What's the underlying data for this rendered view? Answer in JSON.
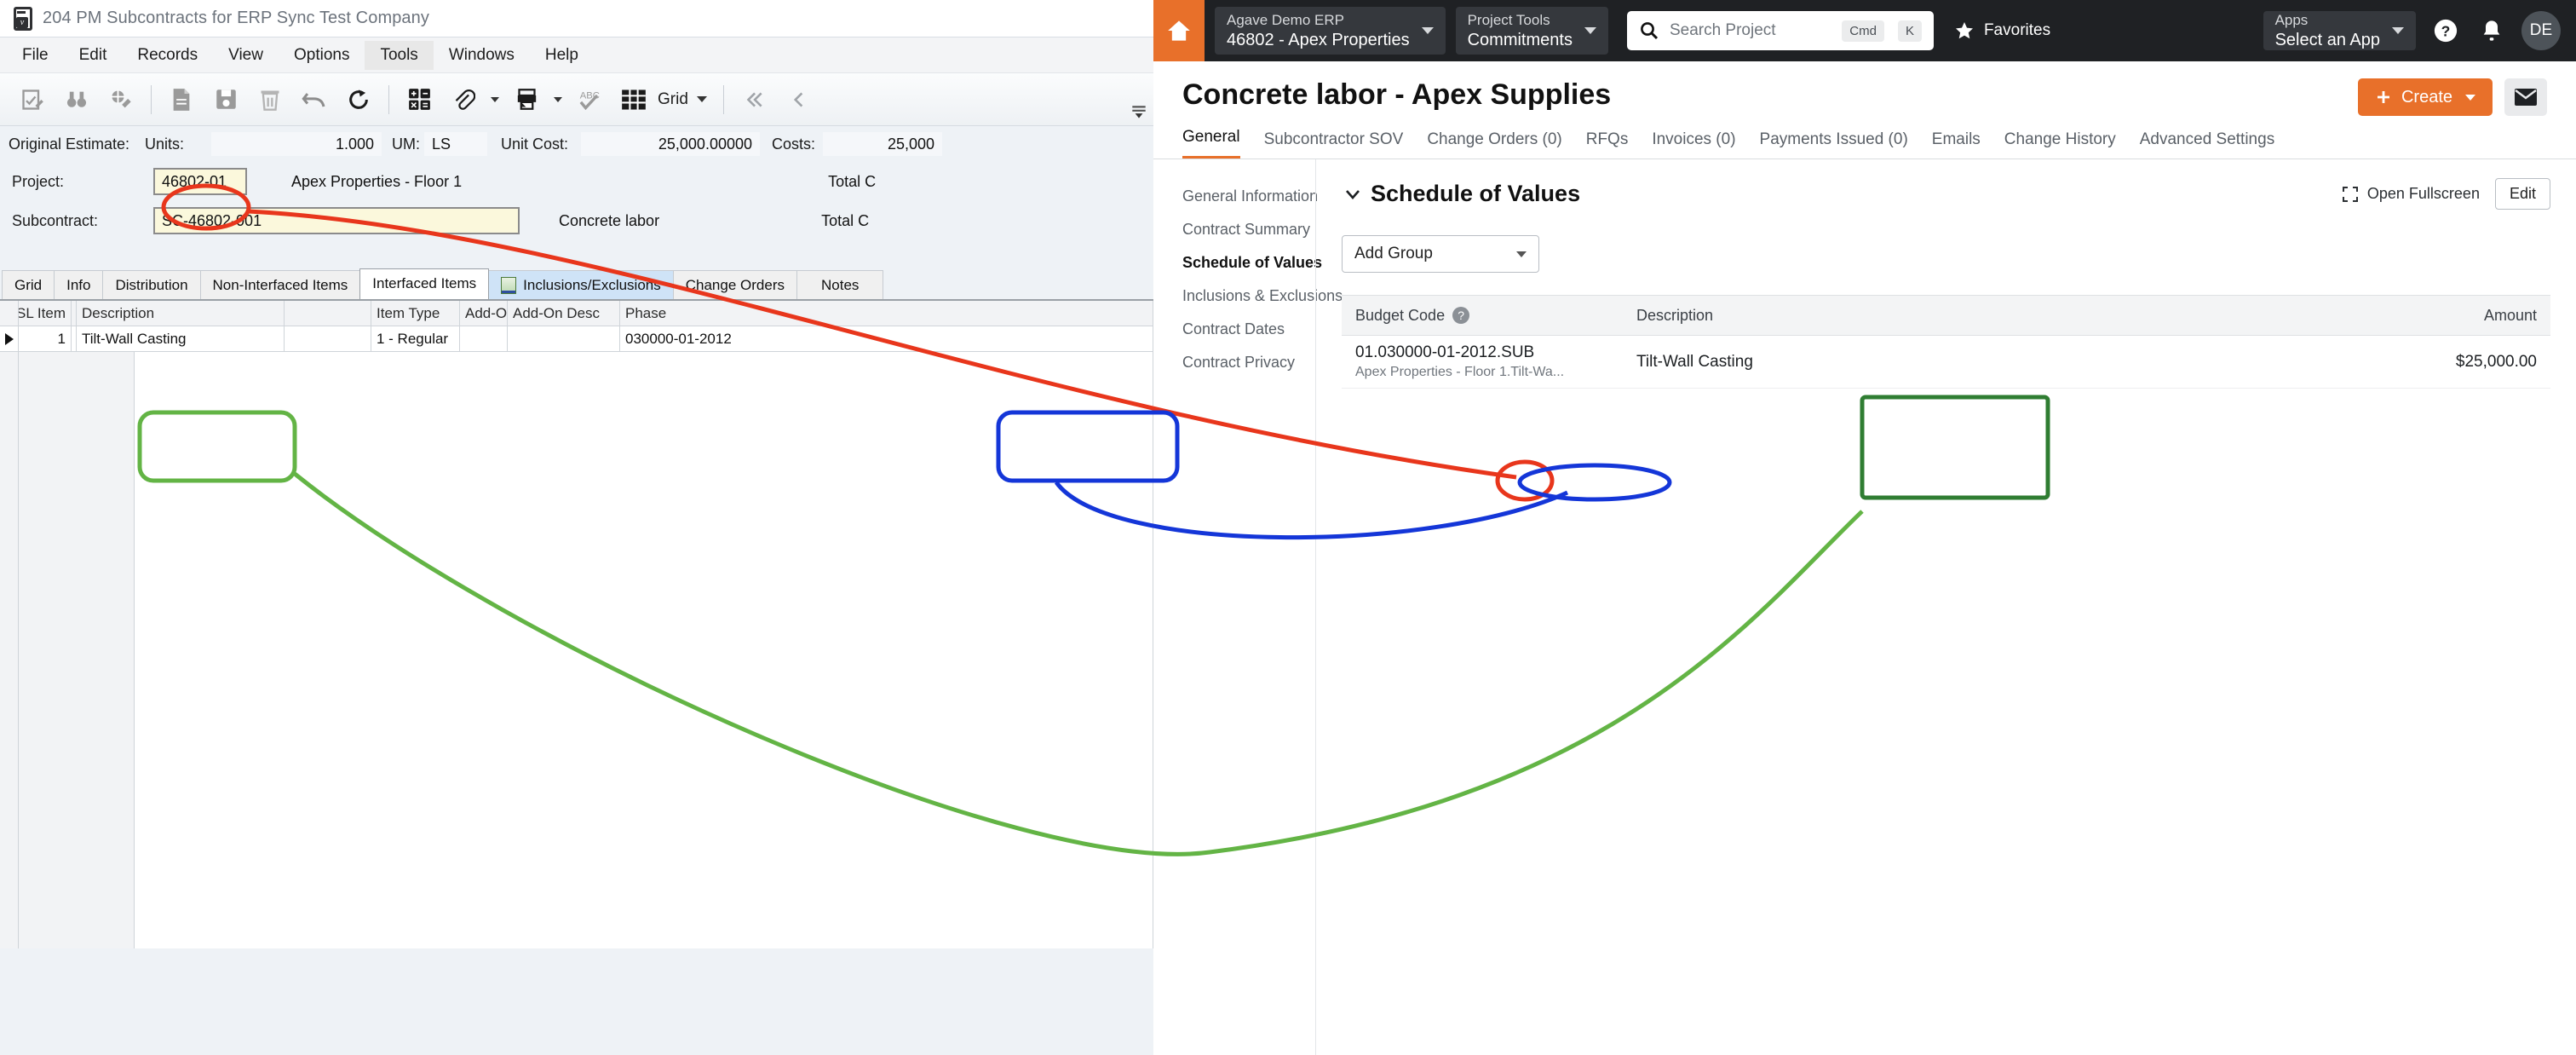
{
  "desktop": {
    "window_title": "204 PM Subcontracts for ERP Sync Test Company",
    "app_icon": "erp-document-icon",
    "menus": [
      "File",
      "Edit",
      "Records",
      "View",
      "Options",
      "Tools",
      "Windows",
      "Help"
    ],
    "highlighted_menu": "Tools",
    "toolbar": {
      "icons": [
        "edit-record-icon",
        "find-binoculars-icon",
        "find-clear-icon",
        "new-document-icon",
        "save-icon",
        "delete-icon",
        "undo-icon",
        "refresh-icon",
        "calculator-icon",
        "attachment-icon",
        "print-icon",
        "spellcheck-icon",
        "grid-view-icon"
      ],
      "grid_label": "Grid",
      "nav_first": "first-record-icon",
      "nav_prev": "previous-record-icon"
    },
    "estimate_row": {
      "label": "Original Estimate:",
      "units_label": "Units:",
      "units_value": "1.000",
      "um_label": "UM:",
      "um_value": "LS",
      "unit_cost_label": "Unit Cost:",
      "unit_cost_value": "25,000.00000",
      "costs_label": "Costs:",
      "costs_value": "25,000"
    },
    "project_row": {
      "label": "Project:",
      "value": "46802-01",
      "description": "Apex Properties - Floor 1",
      "total_label": "Total C"
    },
    "subcontract_row": {
      "label": "Subcontract:",
      "value": "SC-46802-001",
      "description": "Concrete labor",
      "total_label": "Total C"
    },
    "tabs": [
      {
        "label": "Grid",
        "state": "normal"
      },
      {
        "label": "Info",
        "state": "normal"
      },
      {
        "label": "Distribution",
        "state": "normal"
      },
      {
        "label": "Non-Interfaced Items",
        "state": "normal"
      },
      {
        "label": "Interfaced Items",
        "state": "active"
      },
      {
        "label": "Inclusions/Exclusions",
        "state": "blue"
      },
      {
        "label": "Change Orders",
        "state": "normal"
      },
      {
        "label": "Notes",
        "state": "normal"
      }
    ],
    "grid": {
      "columns": [
        "SL Item",
        "Description",
        "Item Type",
        "Add-On",
        "Add-On Desc",
        "Phase"
      ],
      "rows": [
        {
          "sl_item": "1",
          "description": "Tilt-Wall Casting",
          "item_type": "1 - Regular",
          "add_on": "",
          "add_on_desc": "",
          "phase": "030000-01-2012"
        }
      ]
    }
  },
  "web": {
    "header": {
      "home_icon": "home-icon",
      "company_chip": {
        "line1": "Agave Demo ERP",
        "line2": "46802 - Apex Properties"
      },
      "tools_chip": {
        "line1": "Project Tools",
        "line2": "Commitments"
      },
      "search": {
        "placeholder": "Search Project",
        "key1": "Cmd",
        "key2": "K",
        "icon": "search-icon"
      },
      "favorites": {
        "label": "Favorites",
        "icon": "star-icon"
      },
      "apps_chip": {
        "line1": "Apps",
        "line2": "Select an App"
      },
      "help_icon": "help-icon",
      "notifications_icon": "bell-icon",
      "avatar_initials": "DE"
    },
    "page_title": "Concrete labor - Apex Supplies",
    "create_button": {
      "label": "Create",
      "icon": "plus-icon"
    },
    "email_button_icon": "envelope-icon",
    "tabs": [
      {
        "label": "General",
        "active": true
      },
      {
        "label": "Subcontractor SOV",
        "active": false
      },
      {
        "label": "Change Orders (0)",
        "active": false
      },
      {
        "label": "RFQs",
        "active": false
      },
      {
        "label": "Invoices (0)",
        "active": false
      },
      {
        "label": "Payments Issued (0)",
        "active": false
      },
      {
        "label": "Emails",
        "active": false
      },
      {
        "label": "Change History",
        "active": false
      },
      {
        "label": "Advanced Settings",
        "active": false
      }
    ],
    "sidebar": [
      {
        "label": "General Information",
        "active": false
      },
      {
        "label": "Contract Summary",
        "active": false
      },
      {
        "label": "Schedule of Values",
        "active": true
      },
      {
        "label": "Inclusions & Exclusions",
        "active": false
      },
      {
        "label": "Contract Dates",
        "active": false
      },
      {
        "label": "Contract Privacy",
        "active": false
      }
    ],
    "sov": {
      "section_title": "Schedule of Values",
      "chevron_icon": "chevron-down-icon",
      "fullscreen_label": "Open Fullscreen",
      "fullscreen_icon": "fullscreen-icon",
      "edit_label": "Edit",
      "add_group_label": "Add Group",
      "columns": {
        "budget_code": "Budget Code",
        "budget_code_help_icon": "help-icon",
        "description": "Description",
        "amount": "Amount"
      },
      "rows": [
        {
          "budget_code": "01.030000-01-2012.SUB",
          "budget_code_sub": "Apex Properties - Floor 1.Tilt-Wa...",
          "description": "Tilt-Wall Casting",
          "amount": "$25,000.00"
        }
      ]
    }
  },
  "annotations": {
    "colors": {
      "red": "#e8361c",
      "blue": "#1436d8",
      "green": "#63b445",
      "orange": "#e8702a"
    },
    "callouts": [
      {
        "name": "project-code-link",
        "color": "red",
        "from": "46802-01",
        "to": "01.030000-01-2012.SUB"
      },
      {
        "name": "phase-code-link",
        "color": "blue",
        "from": "030000-01-2012",
        "to": "01.030000-01-2012.SUB"
      },
      {
        "name": "description-link",
        "color": "green",
        "from": "Tilt-Wall Casting",
        "to": "Tilt-Wall Casting"
      }
    ]
  }
}
